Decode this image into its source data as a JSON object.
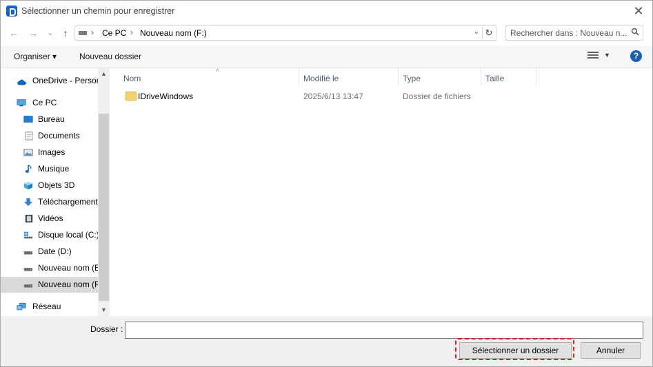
{
  "window": {
    "title": "Sélectionner un chemin pour enregistrer",
    "close_glyph": "✕"
  },
  "nav": {
    "back_glyph": "←",
    "forward_glyph": "→",
    "recent_glyph": "⌄",
    "up_glyph": "↑",
    "breadcrumb": [
      "Ce PC",
      "Nouveau nom (F:)"
    ],
    "refresh_glyph": "↻",
    "search_placeholder": "Rechercher dans : Nouveau n...",
    "search_icon": "search-icon"
  },
  "toolbar": {
    "organize_label": "Organiser ▾",
    "new_folder_label": "Nouveau dossier",
    "help_label": "?"
  },
  "sidebar": {
    "items": [
      {
        "label": "OneDrive - Person",
        "icon": "cloud-icon"
      },
      {
        "label": "Ce PC",
        "icon": "computer-icon"
      },
      {
        "label": "Bureau",
        "icon": "desktop-icon"
      },
      {
        "label": "Documents",
        "icon": "documents-icon"
      },
      {
        "label": "Images",
        "icon": "images-icon"
      },
      {
        "label": "Musique",
        "icon": "music-icon"
      },
      {
        "label": "Objets 3D",
        "icon": "cube-icon"
      },
      {
        "label": "Téléchargements",
        "icon": "download-icon"
      },
      {
        "label": "Vidéos",
        "icon": "video-icon"
      },
      {
        "label": "Disque local (C:)",
        "icon": "windows-drive-icon"
      },
      {
        "label": "Date (D:)",
        "icon": "drive-icon"
      },
      {
        "label": "Nouveau nom (E",
        "icon": "drive-icon"
      },
      {
        "label": "Nouveau nom (F",
        "icon": "drive-icon",
        "selected": true
      },
      {
        "label": "Réseau",
        "icon": "network-icon"
      }
    ]
  },
  "filelist": {
    "columns": [
      "Nom",
      "Modifié le",
      "Type",
      "Taille"
    ],
    "sort_glyph": "^",
    "rows": [
      {
        "name": "IDriveWindows",
        "modified": "2025/6/13 13:47",
        "type": "Dossier de fichiers",
        "size": ""
      }
    ]
  },
  "footer": {
    "folder_label": "Dossier :",
    "folder_value": "",
    "select_button": "Sélectionner un dossier",
    "cancel_button": "Annuler"
  },
  "colors": {
    "highlight": "#e01b1b",
    "accent": "#1a5fb4"
  }
}
